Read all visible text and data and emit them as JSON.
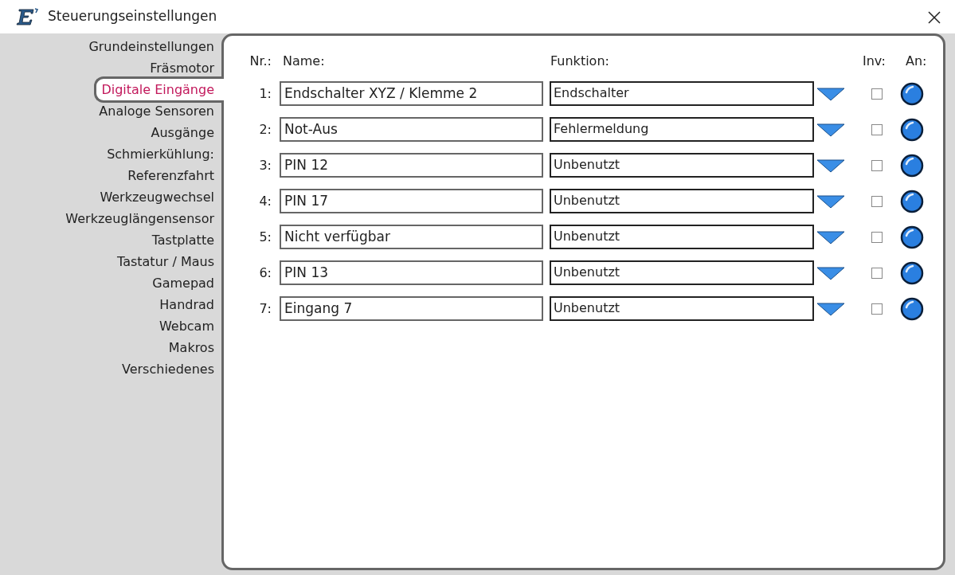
{
  "window": {
    "title": "Steuerungseinstellungen"
  },
  "sidebar": {
    "items": [
      {
        "label": "Grundeinstellungen",
        "selected": false
      },
      {
        "label": "Fräsmotor",
        "selected": false
      },
      {
        "label": "Digitale Eingänge",
        "selected": true
      },
      {
        "label": "Analoge Sensoren",
        "selected": false
      },
      {
        "label": "Ausgänge",
        "selected": false
      },
      {
        "label": "Schmierkühlung:",
        "selected": false
      },
      {
        "label": "Referenzfahrt",
        "selected": false
      },
      {
        "label": "Werkzeugwechsel",
        "selected": false
      },
      {
        "label": "Werkzeuglängensensor",
        "selected": false
      },
      {
        "label": "Tastplatte",
        "selected": false
      },
      {
        "label": "Tastatur / Maus",
        "selected": false
      },
      {
        "label": "Gamepad",
        "selected": false
      },
      {
        "label": "Handrad",
        "selected": false
      },
      {
        "label": "Webcam",
        "selected": false
      },
      {
        "label": "Makros",
        "selected": false
      },
      {
        "label": "Verschiedenes",
        "selected": false
      }
    ]
  },
  "table": {
    "columns": [
      "Nr.:",
      "Name:",
      "Funktion:",
      "Inv:",
      "An:"
    ],
    "rows": [
      {
        "nr": "1:",
        "name": "Endschalter XYZ / Klemme 2",
        "function": "Endschalter",
        "inverted": false,
        "on": true
      },
      {
        "nr": "2:",
        "name": "Not-Aus",
        "function": "Fehlermeldung",
        "inverted": false,
        "on": true
      },
      {
        "nr": "3:",
        "name": "PIN 12",
        "function": "Unbenutzt",
        "inverted": false,
        "on": true
      },
      {
        "nr": "4:",
        "name": "PIN 17",
        "function": "Unbenutzt",
        "inverted": false,
        "on": true
      },
      {
        "nr": "5:",
        "name": "Nicht verfügbar",
        "function": "Unbenutzt",
        "inverted": false,
        "on": true
      },
      {
        "nr": "6:",
        "name": "PIN 13",
        "function": "Unbenutzt",
        "inverted": false,
        "on": true
      },
      {
        "nr": "7:",
        "name": "Eingang 7",
        "function": "Unbenutzt",
        "inverted": false,
        "on": true
      }
    ]
  }
}
